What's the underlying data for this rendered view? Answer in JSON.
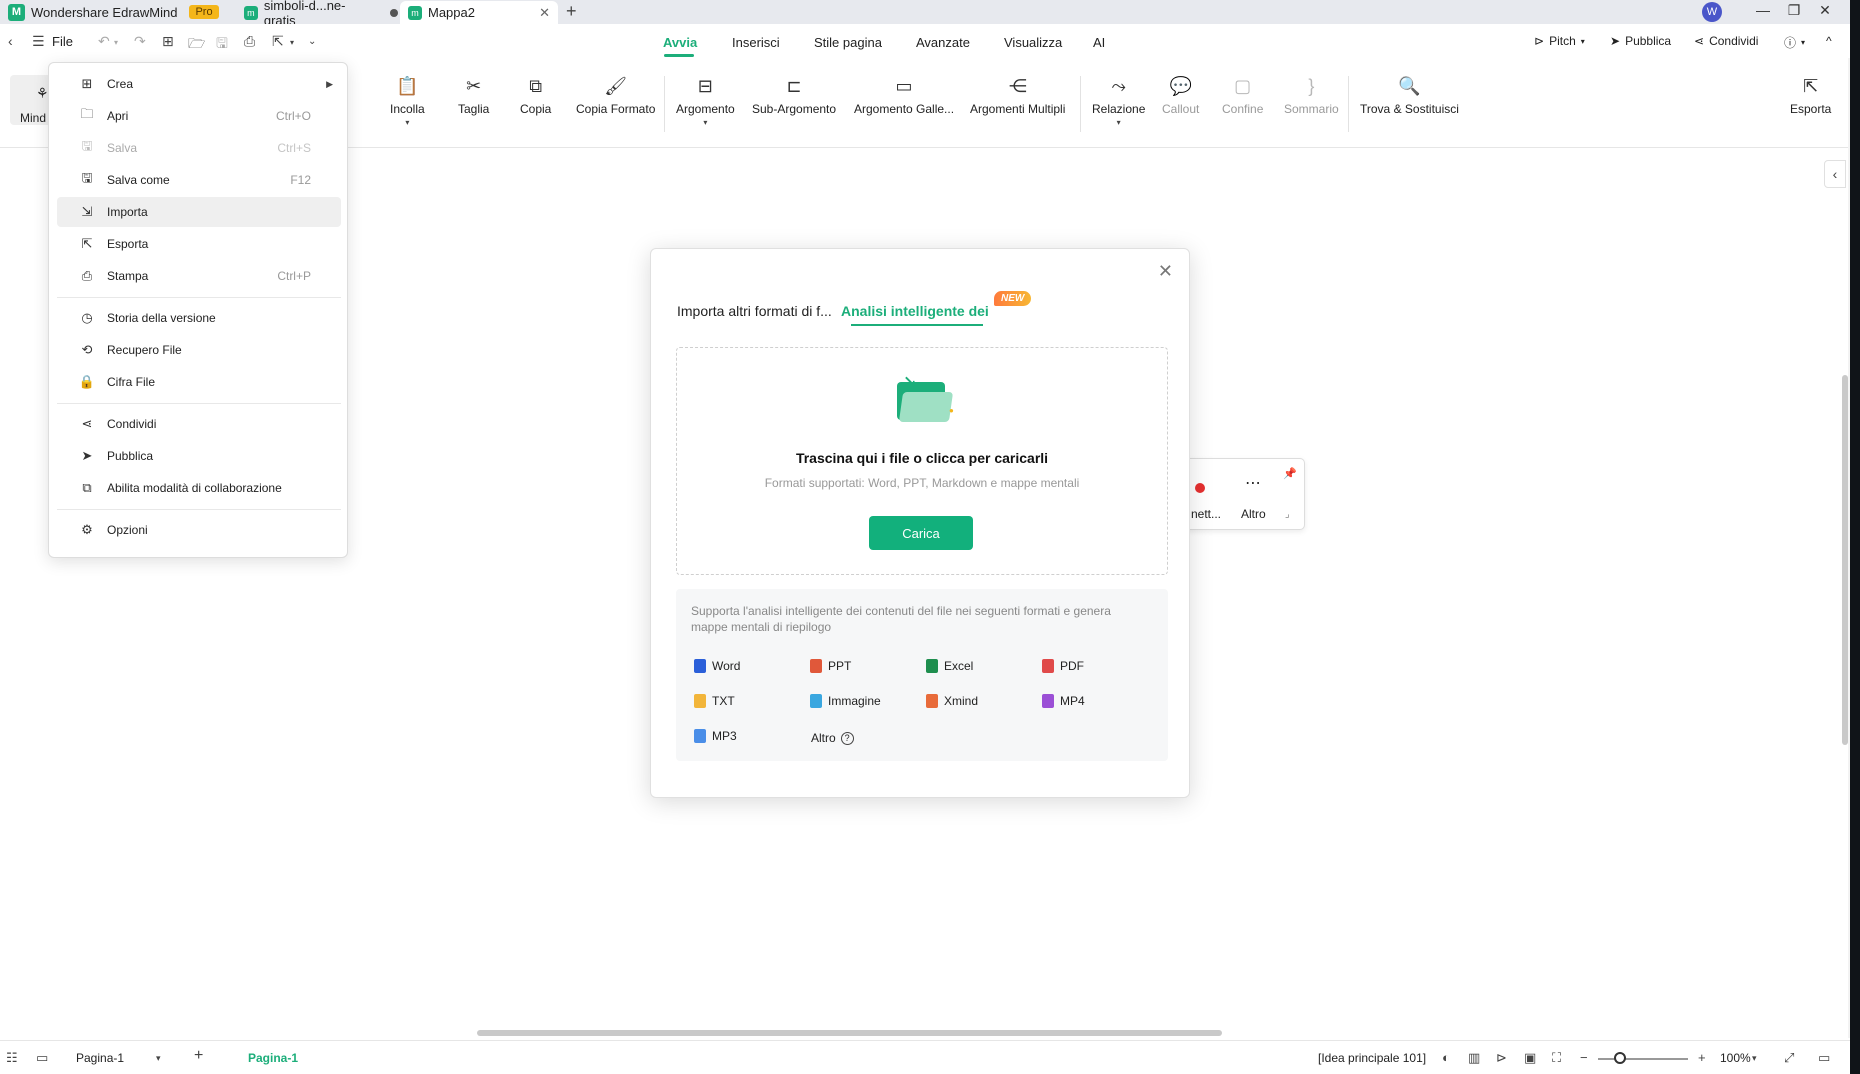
{
  "titlebar": {
    "app_name": "Wondershare EdrawMind",
    "pro_label": "Pro",
    "tabs": [
      {
        "label": "simboli-d...ne-gratis"
      },
      {
        "label": "Mappa2"
      }
    ],
    "new_tab_symbol": "+",
    "avatar_letter": "W"
  },
  "menubar": {
    "file_label": "File",
    "ribbon_tabs": [
      "Avvia",
      "Inserisci",
      "Stile pagina",
      "Avanzate",
      "Visualizza",
      "AI"
    ],
    "right_actions": {
      "pitch": "Pitch",
      "publish": "Pubblica",
      "share": "Condividi"
    }
  },
  "ribbon": {
    "mind_label": "Mind",
    "buttons": [
      {
        "label": "Incolla"
      },
      {
        "label": "Taglia"
      },
      {
        "label": "Copia"
      },
      {
        "label": "Copia Formato"
      },
      {
        "label": "Argomento"
      },
      {
        "label": "Sub-Argomento"
      },
      {
        "label": "Argomento Galle..."
      },
      {
        "label": "Argomenti Multipli"
      },
      {
        "label": "Relazione"
      },
      {
        "label": "Callout"
      },
      {
        "label": "Confine"
      },
      {
        "label": "Sommario"
      },
      {
        "label": "Trova & Sostituisci"
      },
      {
        "label": "Esporta"
      }
    ]
  },
  "file_menu": {
    "items": [
      {
        "label": "Crea",
        "shortcut": "",
        "icon": "plus-square-icon"
      },
      {
        "label": "Apri",
        "shortcut": "Ctrl+O",
        "icon": "folder-icon"
      },
      {
        "label": "Salva",
        "shortcut": "Ctrl+S",
        "icon": "save-icon"
      },
      {
        "label": "Salva come",
        "shortcut": "F12",
        "icon": "save-as-icon"
      },
      {
        "label": "Importa",
        "shortcut": "",
        "icon": "import-icon"
      },
      {
        "label": "Esporta",
        "shortcut": "",
        "icon": "export-icon"
      },
      {
        "label": "Stampa",
        "shortcut": "Ctrl+P",
        "icon": "printer-icon"
      },
      {
        "label": "Storia della versione",
        "shortcut": "",
        "icon": "clock-icon"
      },
      {
        "label": "Recupero File",
        "shortcut": "",
        "icon": "recover-icon"
      },
      {
        "label": "Cifra File",
        "shortcut": "",
        "icon": "lock-file-icon"
      },
      {
        "label": "Condividi",
        "shortcut": "",
        "icon": "share-icon"
      },
      {
        "label": "Pubblica",
        "shortcut": "",
        "icon": "send-icon"
      },
      {
        "label": "Abilita modalità di collaborazione",
        "shortcut": "",
        "icon": "collaboration-icon"
      },
      {
        "label": "Opzioni",
        "shortcut": "",
        "icon": "gear-icon"
      }
    ]
  },
  "floating_toolbar": {
    "partial_label": "nett...",
    "more_label": "Altro"
  },
  "dialog": {
    "tab_other_formats": "Importa altri formati di f...",
    "tab_smart_analysis": "Analisi intelligente dei file",
    "new_badge": "NEW",
    "dropzone_title": "Trascina qui i file o clicca per caricarli",
    "dropzone_subtitle": "Formati supportati: Word, PPT, Markdown e mappe mentali",
    "upload_button": "Carica",
    "info_text": "Supporta l'analisi intelligente dei contenuti del file nei seguenti formati e genera mappe mentali di riepilogo",
    "formats": [
      {
        "label": "Word",
        "color": "#2b5fd9"
      },
      {
        "label": "PPT",
        "color": "#e0583a"
      },
      {
        "label": "Excel",
        "color": "#1e8e4e"
      },
      {
        "label": "PDF",
        "color": "#e04a4a"
      },
      {
        "label": "TXT",
        "color": "#f2b53a"
      },
      {
        "label": "Immagine",
        "color": "#3aa7e0"
      },
      {
        "label": "Xmind",
        "color": "#e86b3a"
      },
      {
        "label": "MP4",
        "color": "#9b4fd6"
      },
      {
        "label": "MP3",
        "color": "#4a8ee8"
      }
    ],
    "more_label": "Altro"
  },
  "statusbar": {
    "page_selector": "Pagina-1",
    "active_page_tab": "Pagina-1",
    "main_idea_count": "[Idea principale 101]",
    "zoom": "100%"
  },
  "colors": {
    "accent": "#1cae7a",
    "upload_button": "#12b07c",
    "pro_badge": "#f4b61a"
  }
}
